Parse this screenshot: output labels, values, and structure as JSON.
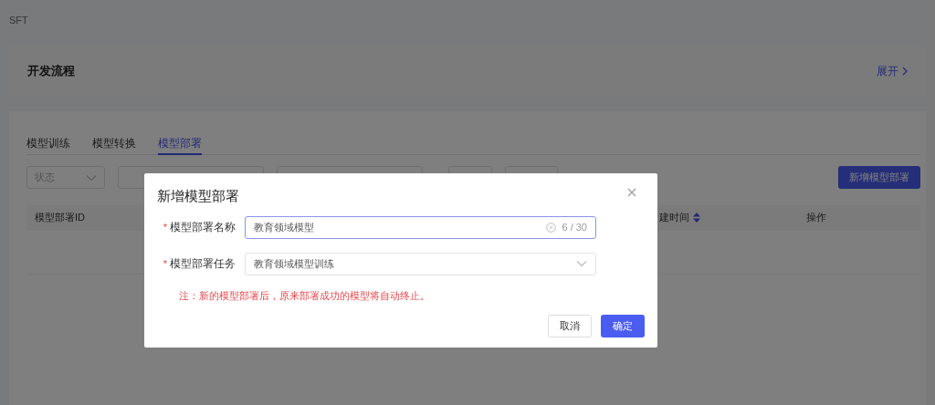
{
  "breadcrumb": "SFT",
  "process_card": {
    "title": "开发流程",
    "toggle": "展开"
  },
  "tabs": [
    {
      "label": "模型训练",
      "selected": false
    },
    {
      "label": "模型转换",
      "selected": false
    },
    {
      "label": "模型部署",
      "selected": true
    }
  ],
  "filters": [
    {
      "kind": "select",
      "placeholder": "状态"
    },
    {
      "kind": "input"
    },
    {
      "kind": "input"
    },
    {
      "kind": "button"
    },
    {
      "kind": "button"
    }
  ],
  "add_button": "新增模型部署",
  "table": {
    "columns": [
      {
        "label": "模型部署ID",
        "sortable": false
      },
      {
        "label": "建时间",
        "sortable": true
      },
      {
        "label": "操作",
        "sortable": false
      }
    ]
  },
  "dialog": {
    "title": "新增模型部署",
    "fields": [
      {
        "kind": "input",
        "label": "模型部署名称",
        "required_mark": "*",
        "value": "教育领域模型",
        "count": "6 / 30",
        "focused": true
      },
      {
        "kind": "select",
        "label": "模型部署任务",
        "required_mark": "*",
        "value": "教育领域模型训练",
        "focused": false
      }
    ],
    "note": "注：新的模型部署后，原来部署成功的模型将自动终止。",
    "buttons": [
      {
        "label": "取消",
        "primary": false
      },
      {
        "label": "确定",
        "primary": true
      }
    ]
  }
}
